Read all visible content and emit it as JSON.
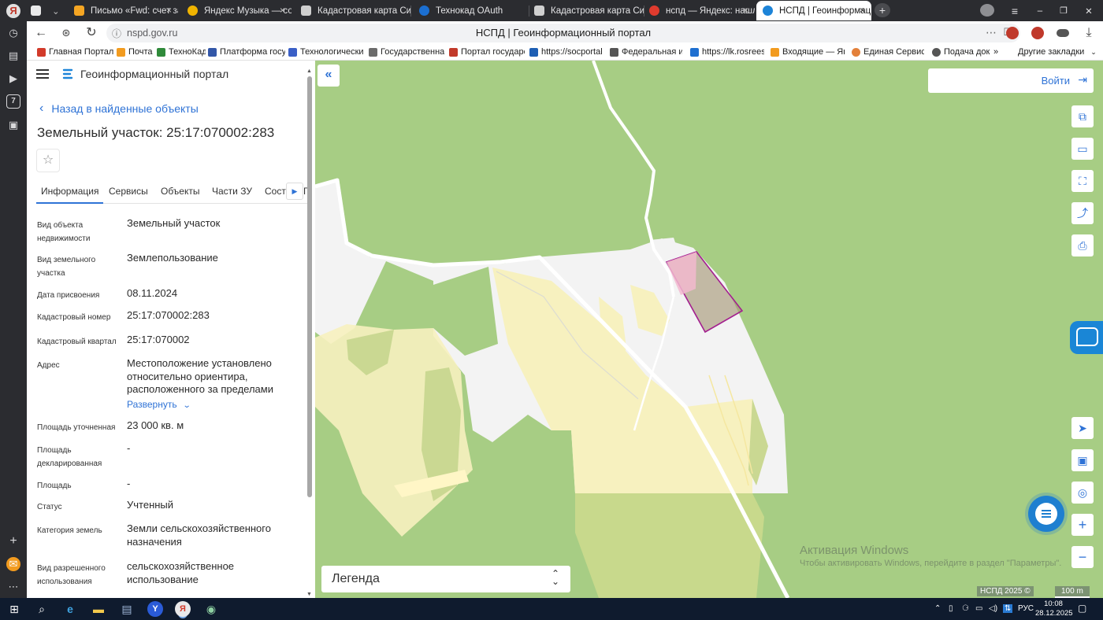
{
  "browser": {
    "tabs": [
      {
        "label": "",
        "color": "#2b5cd8"
      },
      {
        "label": "Письмо «Fwd: счет за дек",
        "color": "#f5a623"
      },
      {
        "label": "Яндекс Музыка — со",
        "color": "#f0b400"
      },
      {
        "label": "Кадастровая карта Сибир",
        "color": "#cfcfcf"
      },
      {
        "label": "Технокад OAuth",
        "color": "#1b6fd1"
      },
      {
        "label": "Кадастровая карта Сибир",
        "color": "#cfcfcf"
      },
      {
        "label": "нспд — Яндекс: нашлось",
        "color": "#e03b2e"
      },
      {
        "label": "НСПД | Геоинформаци",
        "color": "#1d84d8"
      }
    ],
    "close_icon": "×",
    "new_tab": "+",
    "url_domain": "nspd.gov.ru",
    "page_title": "НСПД | Геоинформационный портал",
    "bookmarks": [
      {
        "label": "Главная Портал З",
        "color": "#d23a2a"
      },
      {
        "label": "Почта",
        "color": "#f29b1f"
      },
      {
        "label": "ТехноКад",
        "color": "#2f8a3a"
      },
      {
        "label": "Платформа госуд",
        "color": "#3357a8"
      },
      {
        "label": "Технологический",
        "color": "#3a5fc6"
      },
      {
        "label": "Государственная",
        "color": "#6b6b6b"
      },
      {
        "label": "Портал государст",
        "color": "#c23a2a"
      },
      {
        "label": "https://socportal.",
        "color": "#1e5fb4"
      },
      {
        "label": "Федеральная инф",
        "color": "#555555"
      },
      {
        "label": "https://lk.rosreest",
        "color": "#1e6fd0"
      },
      {
        "label": "Входящие — Янд",
        "color": "#f29b1f"
      },
      {
        "label": "Единая Сервисна",
        "color": "#e3803a"
      },
      {
        "label": "Подача док",
        "color": "#555555"
      }
    ],
    "bookmarks_more": "»",
    "other_bookmarks": "Другие закладки"
  },
  "panel": {
    "portal_title": "Геоинформационный портал",
    "back_label": "Назад в найденные объекты",
    "object_title": "Земельный участок: 25:17:070002:283",
    "tabs": [
      "Информация",
      "Сервисы",
      "Объекты",
      "Части ЗУ",
      "Соста"
    ],
    "tab_overflow": "Г",
    "props": [
      {
        "k": "Вид объекта недвижимости",
        "v": "Земельный участок"
      },
      {
        "k": "Вид земельного участка",
        "v": "Землепользование"
      },
      {
        "k": "Дата присвоения",
        "v": "08.11.2024"
      },
      {
        "k": "Кадастровый номер",
        "v": "25:17:070002:283"
      },
      {
        "k": "Кадастровый квартал",
        "v": "25:17:070002"
      },
      {
        "k": "Адрес",
        "v": "Местоположение установлено относительно ориентира, расположенного за пределами"
      },
      {
        "k": "Площадь уточненная",
        "v": "23 000 кв. м"
      },
      {
        "k": "Площадь декларированная",
        "v": "-"
      },
      {
        "k": "Площадь",
        "v": "-"
      },
      {
        "k": "Статус",
        "v": "Учтенный"
      },
      {
        "k": "Категория земель",
        "v": "Земли сельскохозяйственного назначения"
      },
      {
        "k": "Вид разрешенного использования",
        "v": "сельскохозяйственное использование"
      }
    ],
    "expand_label": "Развернуть"
  },
  "map": {
    "login_label": "Войти",
    "legend_label": "Легенда",
    "activation_title": "Активация Windows",
    "activation_text": "Чтобы активировать Windows, перейдите в раздел \"Параметры\".",
    "attribution": "НСПД 2025 ©",
    "scale_label": "100 m",
    "colors": {
      "forest": "#a7cd84",
      "open": "#f2f2f2",
      "field": "#f7f1bf",
      "parcel_border": "#a31f8f"
    }
  },
  "taskbar": {
    "lang": "РУС",
    "time": "10:08",
    "date": "28.12.2025"
  }
}
